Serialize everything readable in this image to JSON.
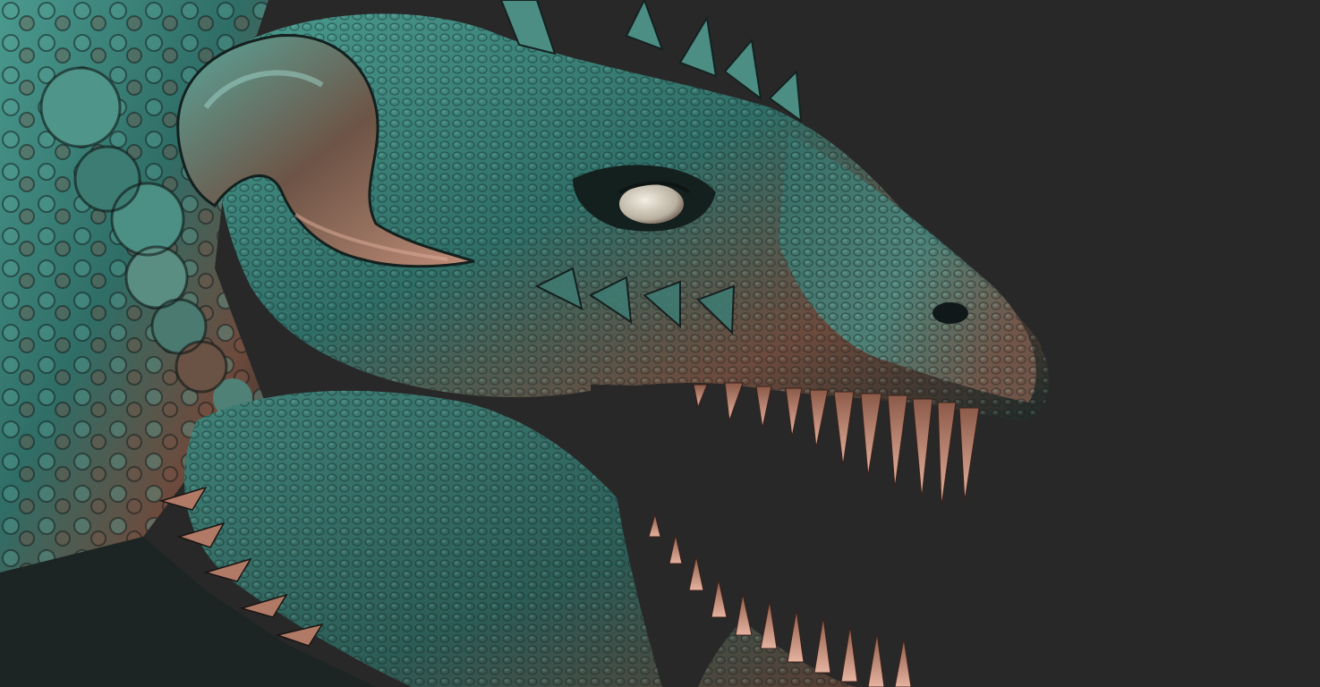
{
  "scene": {
    "subject_icon": "dragon-head-icon",
    "colors": {
      "background": "#282828",
      "skin_teal": "#3f8f86",
      "skin_copper": "#8a5a46",
      "skin_shadow": "#1b2422",
      "teeth": "#d49a86",
      "eye": "#d8d2c4"
    }
  }
}
